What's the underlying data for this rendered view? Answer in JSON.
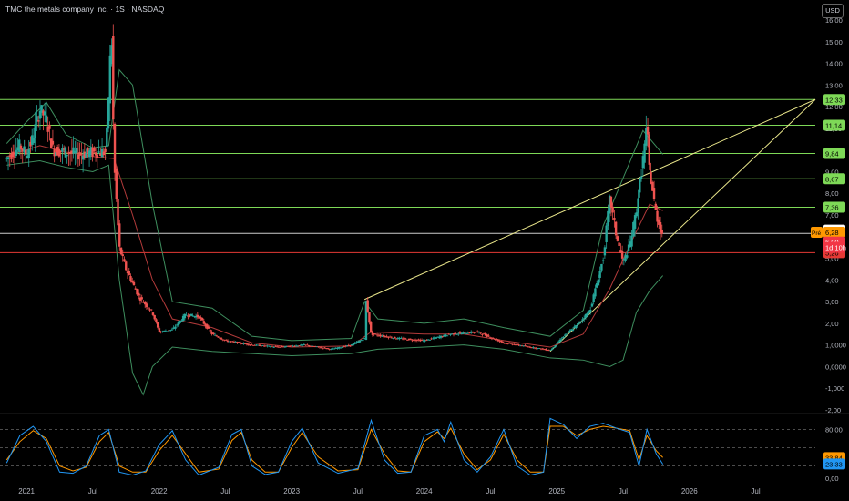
{
  "header": {
    "title": "TMC the metals company Inc. · 1S · NASDAQ",
    "currency": "USD"
  },
  "chart_data": {
    "type": "candlestick",
    "x_ticks": [
      "2021",
      "Jul",
      "2022",
      "Jul",
      "2023",
      "Jul",
      "2024",
      "Jul",
      "2025",
      "Jul",
      "2026",
      "Jul"
    ],
    "x_range": [
      2020.8,
      2026.95
    ],
    "y_range": [
      -2,
      16
    ],
    "y_ticks": [
      -2,
      -1,
      0,
      1,
      2,
      3,
      4,
      5,
      6,
      7,
      8,
      9,
      10,
      11,
      12,
      13,
      14,
      15,
      16
    ],
    "y_tick_labels": [
      "-2,00",
      "-1,000",
      "0,0000",
      "1,0000",
      "2,00",
      "3,00",
      "4,00",
      "5,00",
      "6,00",
      "7,00",
      "8,00",
      "9,00",
      "10,00",
      "11,00",
      "12,00",
      "13,00",
      "14,00",
      "15,00",
      "16,00"
    ],
    "horizontal_levels": [
      {
        "value": 12.33,
        "label": "12,33",
        "color": "#7ed957"
      },
      {
        "value": 11.14,
        "label": "11,14",
        "color": "#7ed957"
      },
      {
        "value": 9.84,
        "label": "9,84",
        "color": "#7ed957"
      },
      {
        "value": 8.67,
        "label": "8,67",
        "color": "#7ed957"
      },
      {
        "value": 7.36,
        "label": "7,36",
        "color": "#7ed957"
      },
      {
        "value": 6.15,
        "label": "",
        "color": "#cccccc"
      },
      {
        "value": 5.26,
        "label": "5,26",
        "color": "#e53935"
      }
    ],
    "price_badges": [
      {
        "value": 6.3,
        "label": "6,30",
        "color": "#ffffff",
        "text": "#000000"
      },
      {
        "value": 6.2,
        "label": "6,28",
        "color": "#ff9800",
        "text": "#000000",
        "prefix": "Pré"
      },
      {
        "value": 5.75,
        "label": "6,00",
        "color": "#f23645",
        "text": "#ffffff"
      },
      {
        "value": 5.5,
        "label": "1d 10h",
        "color": "#f23645",
        "text": "#ffffff"
      }
    ],
    "trendlines": [
      {
        "x1": 2023.55,
        "y1": 3.1,
        "x2": 2026.95,
        "y2": 12.33
      },
      {
        "x1": 2024.95,
        "y1": 0.7,
        "x2": 2026.95,
        "y2": 12.33
      }
    ],
    "price_path": [
      [
        2020.85,
        9.6
      ],
      [
        2020.95,
        10.2
      ],
      [
        2021.0,
        9.8
      ],
      [
        2021.05,
        10.6
      ],
      [
        2021.1,
        11.9
      ],
      [
        2021.15,
        11.4
      ],
      [
        2021.2,
        10.0
      ],
      [
        2021.3,
        9.9
      ],
      [
        2021.4,
        9.8
      ],
      [
        2021.5,
        9.9
      ],
      [
        2021.6,
        9.9
      ],
      [
        2021.64,
        15.6
      ],
      [
        2021.66,
        9.5
      ],
      [
        2021.7,
        5.5
      ],
      [
        2021.75,
        4.5
      ],
      [
        2021.85,
        3.2
      ],
      [
        2021.95,
        2.5
      ],
      [
        2022.0,
        1.6
      ],
      [
        2022.1,
        1.7
      ],
      [
        2022.2,
        2.4
      ],
      [
        2022.3,
        2.3
      ],
      [
        2022.4,
        1.5
      ],
      [
        2022.5,
        1.2
      ],
      [
        2022.7,
        1.0
      ],
      [
        2022.9,
        0.9
      ],
      [
        2023.1,
        1.0
      ],
      [
        2023.3,
        0.8
      ],
      [
        2023.45,
        1.0
      ],
      [
        2023.55,
        1.3
      ],
      [
        2023.56,
        3.1
      ],
      [
        2023.6,
        1.5
      ],
      [
        2023.8,
        1.3
      ],
      [
        2024.0,
        1.2
      ],
      [
        2024.2,
        1.5
      ],
      [
        2024.4,
        1.6
      ],
      [
        2024.6,
        1.1
      ],
      [
        2024.8,
        0.9
      ],
      [
        2024.95,
        0.75
      ],
      [
        2025.05,
        1.4
      ],
      [
        2025.15,
        1.9
      ],
      [
        2025.25,
        2.6
      ],
      [
        2025.35,
        5.0
      ],
      [
        2025.4,
        7.8
      ],
      [
        2025.45,
        6.0
      ],
      [
        2025.5,
        4.8
      ],
      [
        2025.55,
        5.6
      ],
      [
        2025.6,
        7.2
      ],
      [
        2025.65,
        9.6
      ],
      [
        2025.68,
        11.1
      ],
      [
        2025.7,
        9.0
      ],
      [
        2025.75,
        7.0
      ],
      [
        2025.8,
        6.0
      ]
    ],
    "bb_upper": [
      [
        2020.85,
        10.3
      ],
      [
        2021.0,
        11.3
      ],
      [
        2021.15,
        12.2
      ],
      [
        2021.3,
        10.7
      ],
      [
        2021.5,
        10.1
      ],
      [
        2021.62,
        10.2
      ],
      [
        2021.7,
        13.7
      ],
      [
        2021.8,
        13.0
      ],
      [
        2021.95,
        7.5
      ],
      [
        2022.1,
        3.0
      ],
      [
        2022.4,
        2.7
      ],
      [
        2022.7,
        1.4
      ],
      [
        2023.0,
        1.2
      ],
      [
        2023.45,
        1.3
      ],
      [
        2023.55,
        3.0
      ],
      [
        2023.65,
        2.2
      ],
      [
        2024.0,
        2.0
      ],
      [
        2024.3,
        2.2
      ],
      [
        2024.6,
        1.8
      ],
      [
        2024.95,
        1.4
      ],
      [
        2025.2,
        2.6
      ],
      [
        2025.35,
        6.5
      ],
      [
        2025.5,
        8.7
      ],
      [
        2025.65,
        10.9
      ],
      [
        2025.8,
        9.8
      ]
    ],
    "bb_lower": [
      [
        2020.85,
        9.3
      ],
      [
        2021.1,
        9.5
      ],
      [
        2021.3,
        9.2
      ],
      [
        2021.5,
        9.0
      ],
      [
        2021.62,
        9.3
      ],
      [
        2021.7,
        4.0
      ],
      [
        2021.8,
        -0.3
      ],
      [
        2021.88,
        -1.3
      ],
      [
        2021.95,
        0.0
      ],
      [
        2022.1,
        0.9
      ],
      [
        2022.4,
        0.7
      ],
      [
        2022.7,
        0.6
      ],
      [
        2023.0,
        0.5
      ],
      [
        2023.45,
        0.6
      ],
      [
        2023.65,
        0.8
      ],
      [
        2024.0,
        0.9
      ],
      [
        2024.3,
        1.0
      ],
      [
        2024.6,
        0.8
      ],
      [
        2024.95,
        0.4
      ],
      [
        2025.2,
        0.3
      ],
      [
        2025.4,
        0.0
      ],
      [
        2025.5,
        0.3
      ],
      [
        2025.6,
        2.5
      ],
      [
        2025.7,
        3.5
      ],
      [
        2025.8,
        4.2
      ]
    ],
    "ma_line": [
      [
        2020.85,
        9.7
      ],
      [
        2021.1,
        10.2
      ],
      [
        2021.3,
        9.9
      ],
      [
        2021.5,
        9.7
      ],
      [
        2021.66,
        9.6
      ],
      [
        2021.8,
        7.0
      ],
      [
        2021.95,
        4.0
      ],
      [
        2022.1,
        2.2
      ],
      [
        2022.4,
        1.8
      ],
      [
        2022.7,
        1.1
      ],
      [
        2023.0,
        0.9
      ],
      [
        2023.45,
        0.95
      ],
      [
        2023.6,
        1.6
      ],
      [
        2024.0,
        1.5
      ],
      [
        2024.3,
        1.5
      ],
      [
        2024.6,
        1.2
      ],
      [
        2024.95,
        0.9
      ],
      [
        2025.2,
        1.5
      ],
      [
        2025.4,
        3.6
      ],
      [
        2025.55,
        5.6
      ],
      [
        2025.7,
        7.5
      ],
      [
        2025.8,
        7.2
      ]
    ],
    "oscillator": {
      "y_ticks": [
        0,
        20,
        40,
        60,
        80,
        100
      ],
      "y_tick_labels": [
        "0,00",
        "20,00",
        "",
        "",
        "80,00",
        ""
      ],
      "levels": [
        80,
        50,
        20
      ],
      "badges": [
        {
          "value": 33.84,
          "label": "33,84",
          "color": "#ff9800"
        },
        {
          "value": 23.33,
          "label": "23,33",
          "color": "#2196f3"
        }
      ],
      "k_line": [
        [
          2020.85,
          25
        ],
        [
          2020.95,
          70
        ],
        [
          2021.05,
          85
        ],
        [
          2021.15,
          60
        ],
        [
          2021.25,
          10
        ],
        [
          2021.35,
          8
        ],
        [
          2021.45,
          20
        ],
        [
          2021.55,
          70
        ],
        [
          2021.62,
          80
        ],
        [
          2021.7,
          10
        ],
        [
          2021.8,
          5
        ],
        [
          2021.9,
          12
        ],
        [
          2022.0,
          55
        ],
        [
          2022.1,
          78
        ],
        [
          2022.2,
          30
        ],
        [
          2022.3,
          5
        ],
        [
          2022.45,
          18
        ],
        [
          2022.55,
          72
        ],
        [
          2022.62,
          80
        ],
        [
          2022.7,
          20
        ],
        [
          2022.8,
          6
        ],
        [
          2022.9,
          10
        ],
        [
          2023.0,
          60
        ],
        [
          2023.08,
          82
        ],
        [
          2023.2,
          25
        ],
        [
          2023.35,
          8
        ],
        [
          2023.5,
          16
        ],
        [
          2023.6,
          95
        ],
        [
          2023.7,
          30
        ],
        [
          2023.8,
          8
        ],
        [
          2023.9,
          10
        ],
        [
          2024.0,
          70
        ],
        [
          2024.1,
          80
        ],
        [
          2024.15,
          60
        ],
        [
          2024.2,
          92
        ],
        [
          2024.3,
          30
        ],
        [
          2024.4,
          10
        ],
        [
          2024.5,
          35
        ],
        [
          2024.6,
          80
        ],
        [
          2024.7,
          20
        ],
        [
          2024.8,
          5
        ],
        [
          2024.9,
          10
        ],
        [
          2024.95,
          98
        ],
        [
          2025.05,
          88
        ],
        [
          2025.15,
          65
        ],
        [
          2025.25,
          85
        ],
        [
          2025.35,
          90
        ],
        [
          2025.45,
          82
        ],
        [
          2025.55,
          75
        ],
        [
          2025.62,
          20
        ],
        [
          2025.68,
          80
        ],
        [
          2025.75,
          40
        ],
        [
          2025.8,
          23
        ]
      ],
      "d_line": [
        [
          2020.85,
          30
        ],
        [
          2020.95,
          60
        ],
        [
          2021.05,
          78
        ],
        [
          2021.15,
          65
        ],
        [
          2021.25,
          20
        ],
        [
          2021.35,
          12
        ],
        [
          2021.45,
          18
        ],
        [
          2021.55,
          60
        ],
        [
          2021.62,
          75
        ],
        [
          2021.7,
          20
        ],
        [
          2021.8,
          10
        ],
        [
          2021.9,
          10
        ],
        [
          2022.0,
          45
        ],
        [
          2022.1,
          70
        ],
        [
          2022.2,
          40
        ],
        [
          2022.3,
          10
        ],
        [
          2022.45,
          15
        ],
        [
          2022.55,
          62
        ],
        [
          2022.62,
          75
        ],
        [
          2022.7,
          30
        ],
        [
          2022.8,
          10
        ],
        [
          2022.9,
          10
        ],
        [
          2023.0,
          50
        ],
        [
          2023.08,
          75
        ],
        [
          2023.2,
          35
        ],
        [
          2023.35,
          12
        ],
        [
          2023.5,
          14
        ],
        [
          2023.6,
          80
        ],
        [
          2023.7,
          40
        ],
        [
          2023.8,
          12
        ],
        [
          2023.9,
          10
        ],
        [
          2024.0,
          60
        ],
        [
          2024.1,
          76
        ],
        [
          2024.15,
          65
        ],
        [
          2024.2,
          82
        ],
        [
          2024.3,
          40
        ],
        [
          2024.4,
          14
        ],
        [
          2024.5,
          30
        ],
        [
          2024.6,
          72
        ],
        [
          2024.7,
          30
        ],
        [
          2024.8,
          10
        ],
        [
          2024.9,
          10
        ],
        [
          2024.95,
          85
        ],
        [
          2025.05,
          85
        ],
        [
          2025.15,
          70
        ],
        [
          2025.25,
          80
        ],
        [
          2025.35,
          85
        ],
        [
          2025.45,
          82
        ],
        [
          2025.55,
          78
        ],
        [
          2025.62,
          30
        ],
        [
          2025.68,
          70
        ],
        [
          2025.75,
          45
        ],
        [
          2025.8,
          34
        ]
      ]
    }
  }
}
